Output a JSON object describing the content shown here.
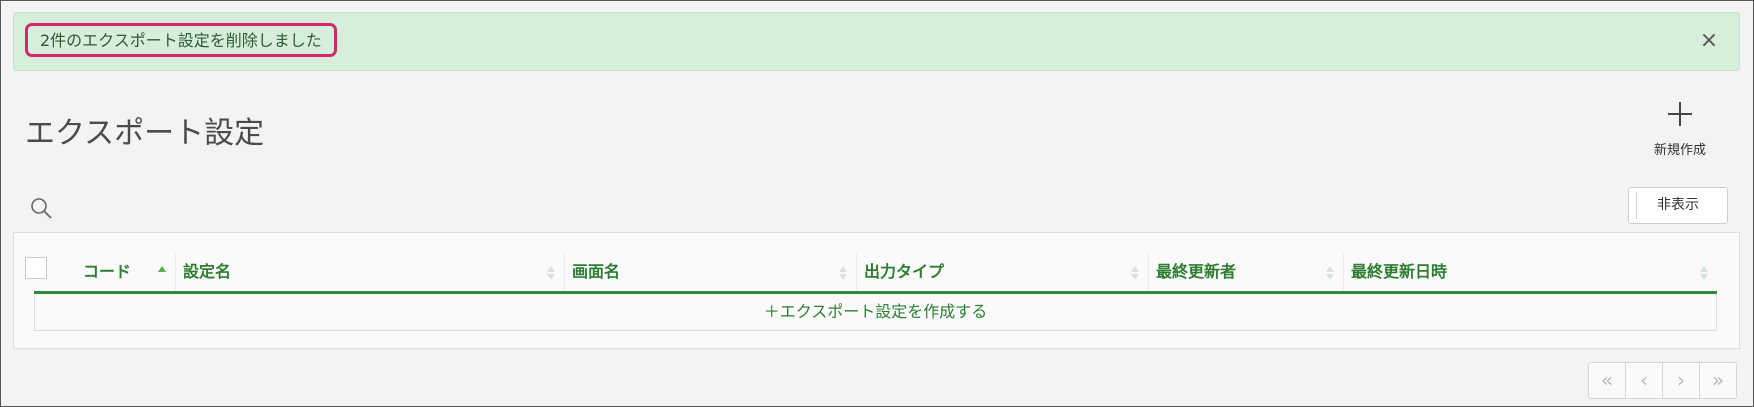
{
  "alert": {
    "message": "2件のエクスポート設定を削除しました",
    "close_label": "×"
  },
  "header": {
    "title": "エクスポート設定",
    "new_button_icon": "plus-icon",
    "new_button_label": "新規作成"
  },
  "toolbar": {
    "search_icon": "search-icon",
    "hide_button_label": "非表示"
  },
  "table": {
    "columns": [
      {
        "label": "コード",
        "sort": "ascending"
      },
      {
        "label": "設定名",
        "sort": "none"
      },
      {
        "label": "画面名",
        "sort": "none"
      },
      {
        "label": "出力タイプ",
        "sort": "none"
      },
      {
        "label": "最終更新者",
        "sort": "none"
      },
      {
        "label": "最終更新日時",
        "sort": "none"
      }
    ],
    "create_row_label": "＋エクスポート設定を作成する"
  },
  "pagination": {
    "first": "«",
    "prev": "‹",
    "next": "›",
    "last": "»"
  },
  "colors": {
    "accent_green": "#2e7d32",
    "alert_bg": "#d7eedb",
    "highlight_border": "#d1286d"
  }
}
